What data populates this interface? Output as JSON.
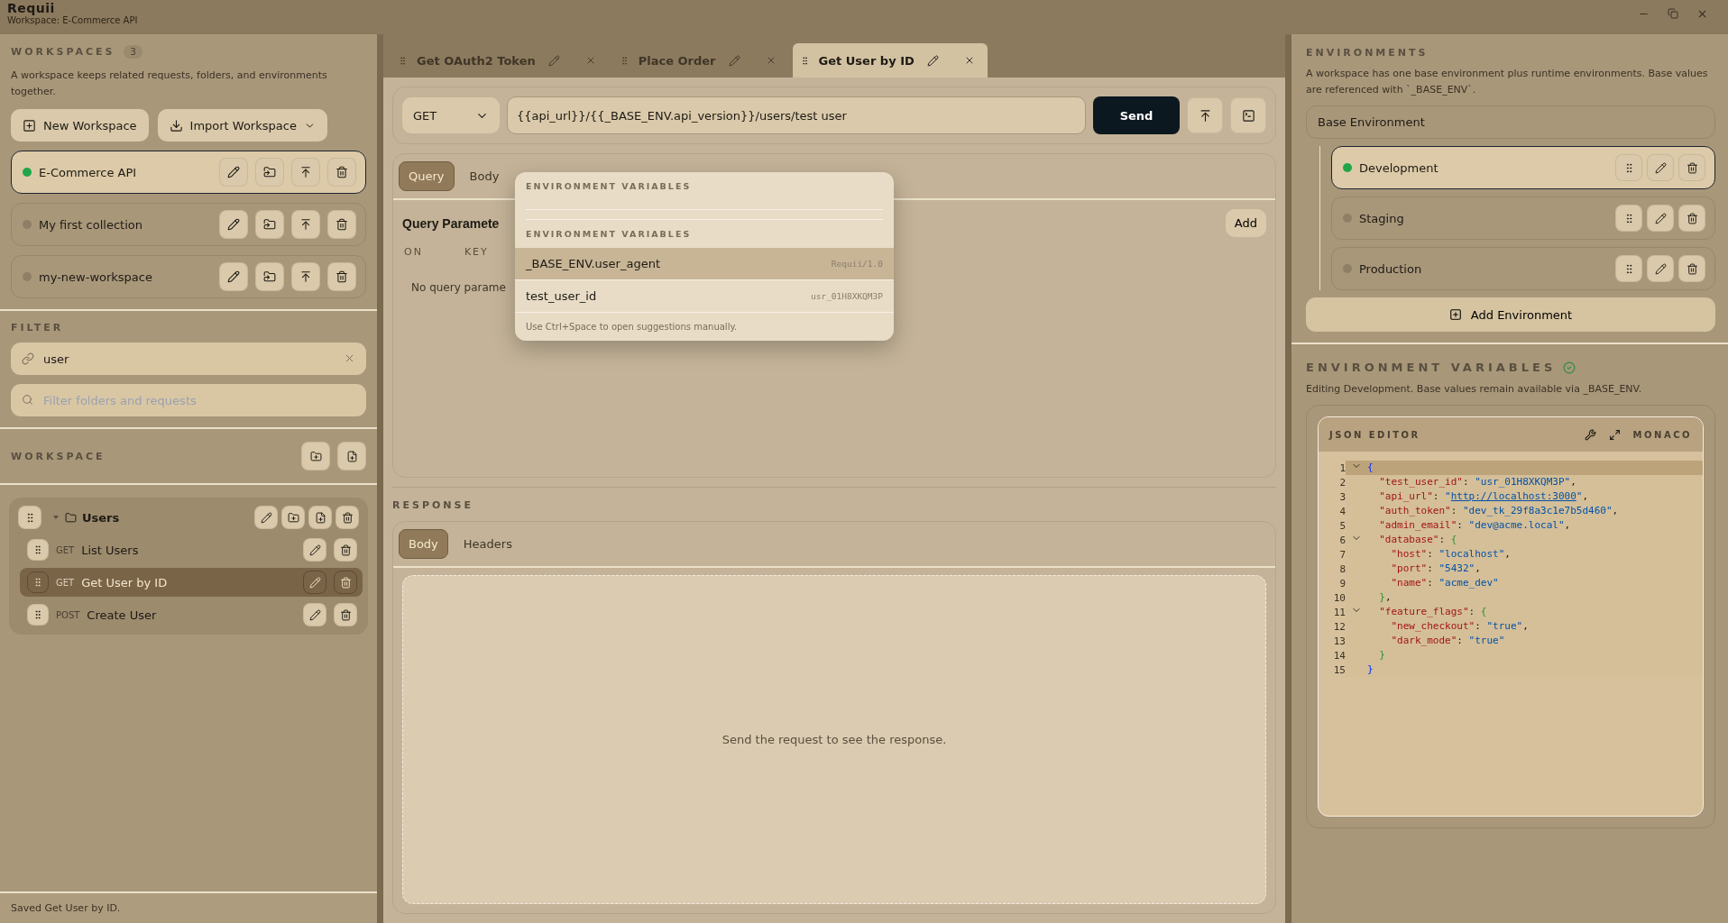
{
  "app": {
    "title": "Requii",
    "subtitle": "Workspace: E-Commerce API"
  },
  "workspaces": {
    "heading": "WORKSPACES",
    "count": "3",
    "description": "A workspace keeps related requests, folders, and environments together.",
    "buttons": [
      {
        "label": "New Workspace",
        "kind": "new"
      },
      {
        "label": "Import Workspace",
        "kind": "import"
      }
    ],
    "items": [
      {
        "name": "E-Commerce API",
        "selected": true
      },
      {
        "name": "My first collection",
        "selected": false
      },
      {
        "name": "my-new-workspace",
        "selected": false
      }
    ]
  },
  "filter": {
    "heading": "FILTER",
    "value": "user",
    "search_placeholder": "Filter folders and requests"
  },
  "tree": {
    "heading": "WORKSPACE",
    "folders": [
      {
        "name": "Users",
        "expanded": true,
        "children": [
          {
            "method": "GET",
            "name": "List Users",
            "selected": false
          },
          {
            "method": "GET",
            "name": "Get User by ID",
            "selected": true
          },
          {
            "method": "POST",
            "name": "Create User",
            "selected": false
          }
        ]
      }
    ]
  },
  "status_bar": "Saved Get User by ID.",
  "tabs": [
    {
      "label": "Get OAuth2 Token",
      "selected": false
    },
    {
      "label": "Place Order",
      "selected": false
    },
    {
      "label": "Get User by ID",
      "selected": true
    }
  ],
  "request": {
    "method": "GET",
    "url": "{{api_url}}/{{_BASE_ENV.api_version}}/users/test user",
    "send": "Send",
    "tabs": [
      {
        "label": "Query",
        "selected": true
      },
      {
        "label": "Body",
        "selected": false
      }
    ],
    "params_heading": "Query Paramete",
    "add": "Add",
    "columns": [
      "ON",
      "KEY"
    ],
    "empty": "No query parame"
  },
  "suggestions": {
    "heading": "ENVIRONMENT VARIABLES",
    "group_heading": "ENVIRONMENT VARIABLES",
    "items": [
      {
        "name": "_BASE_ENV.user_agent",
        "value": "Requii/1.0",
        "selected": true
      },
      {
        "name": "test_user_id",
        "value": "usr_01H8XKQM3P",
        "selected": false
      }
    ],
    "hint": "Use Ctrl+Space to open suggestions manually."
  },
  "response": {
    "heading": "RESPONSE",
    "tabs": [
      {
        "label": "Body",
        "selected": true
      },
      {
        "label": "Headers",
        "selected": false
      }
    ],
    "empty": "Send the request to see the response."
  },
  "environments": {
    "heading": "ENVIRONMENTS",
    "description": "A workspace has one base environment plus runtime environments. Base values are referenced with `_BASE_ENV`.",
    "base": "Base Environment",
    "items": [
      {
        "name": "Development",
        "selected": true
      },
      {
        "name": "Staging",
        "selected": false
      },
      {
        "name": "Production",
        "selected": false
      }
    ],
    "add": "Add Environment"
  },
  "variables": {
    "heading": "ENVIRONMENT VARIABLES",
    "valid": true,
    "description": "Editing Development. Base values remain available via _BASE_ENV.",
    "editor": {
      "title": "JSON EDITOR",
      "mode": "MONACO",
      "lines": [
        {
          "number": "1",
          "text": "{",
          "foldable": true,
          "current": true
        },
        {
          "number": "2",
          "text": "  \"test_user_id\": \"usr_01H8XKQM3P\",",
          "foldable": false,
          "current": false
        },
        {
          "number": "3",
          "text": "  \"api_url\": \"http://localhost:3000\",",
          "foldable": false,
          "current": false
        },
        {
          "number": "4",
          "text": "  \"auth_token\": \"dev_tk_29f8a3c1e7b5d460\",",
          "foldable": false,
          "current": false
        },
        {
          "number": "5",
          "text": "  \"admin_email\": \"dev@acme.local\",",
          "foldable": false,
          "current": false
        },
        {
          "number": "6",
          "text": "  \"database\": {",
          "foldable": true,
          "current": false
        },
        {
          "number": "7",
          "text": "    \"host\": \"localhost\",",
          "foldable": false,
          "current": false
        },
        {
          "number": "8",
          "text": "    \"port\": \"5432\",",
          "foldable": false,
          "current": false
        },
        {
          "number": "9",
          "text": "    \"name\": \"acme_dev\"",
          "foldable": false,
          "current": false
        },
        {
          "number": "10",
          "text": "  },",
          "foldable": false,
          "current": false
        },
        {
          "number": "11",
          "text": "  \"feature_flags\": {",
          "foldable": true,
          "current": false
        },
        {
          "number": "12",
          "text": "    \"new_checkout\": \"true\",",
          "foldable": false,
          "current": false
        },
        {
          "number": "13",
          "text": "    \"dark_mode\": \"true\"",
          "foldable": false,
          "current": false
        },
        {
          "number": "14",
          "text": "  }",
          "foldable": false,
          "current": false
        },
        {
          "number": "15",
          "text": "}",
          "foldable": false,
          "current": false
        }
      ]
    }
  }
}
